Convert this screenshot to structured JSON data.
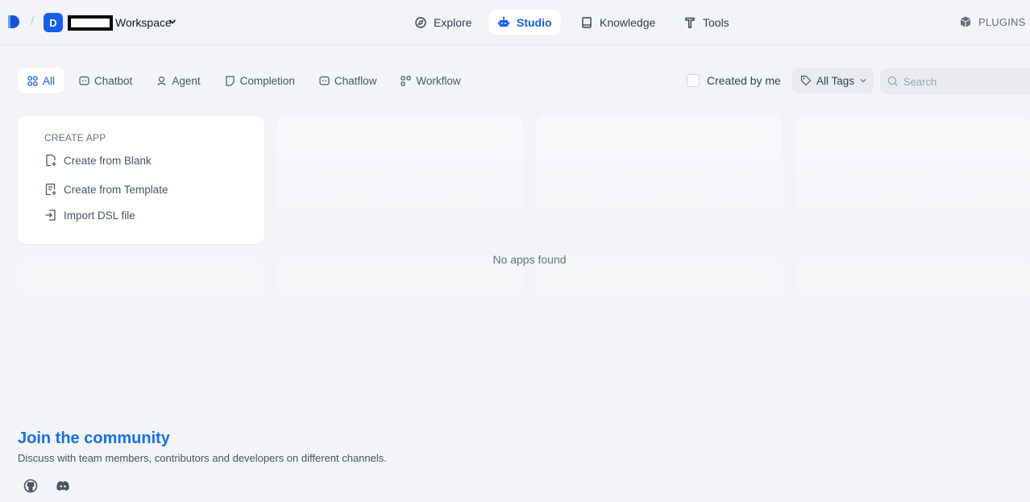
{
  "header": {
    "workspace_initial": "D",
    "workspace_label": "Workspace",
    "nav": [
      {
        "label": "Explore",
        "icon": "compass-icon"
      },
      {
        "label": "Studio",
        "icon": "robot-icon"
      },
      {
        "label": "Knowledge",
        "icon": "book-icon"
      },
      {
        "label": "Tools",
        "icon": "hammer-icon"
      }
    ],
    "plugins_label": "PLUGINS"
  },
  "filters": {
    "tabs": [
      {
        "label": "All",
        "icon": "grid-icon"
      },
      {
        "label": "Chatbot",
        "icon": "chat-icon"
      },
      {
        "label": "Agent",
        "icon": "agent-icon"
      },
      {
        "label": "Completion",
        "icon": "document-icon"
      },
      {
        "label": "Chatflow",
        "icon": "chat-icon"
      },
      {
        "label": "Workflow",
        "icon": "workflow-icon"
      }
    ],
    "created_by_me_label": "Created by me",
    "tags_label": "All Tags",
    "search_placeholder": "Search"
  },
  "create_app": {
    "title": "CREATE APP",
    "items": [
      {
        "label": "Create from Blank",
        "icon": "file-plus-icon"
      },
      {
        "label": "Create from Template",
        "icon": "template-icon"
      },
      {
        "label": "Import DSL file",
        "icon": "import-icon"
      }
    ]
  },
  "empty_message": "No apps found",
  "community": {
    "title": "Join the community",
    "description": "Discuss with team members, contributors and developers on different channels.",
    "links": [
      "github-icon",
      "discord-icon"
    ]
  },
  "colors": {
    "accent": "#155eef",
    "link": "#1570ef",
    "background": "#f2f4f7"
  }
}
